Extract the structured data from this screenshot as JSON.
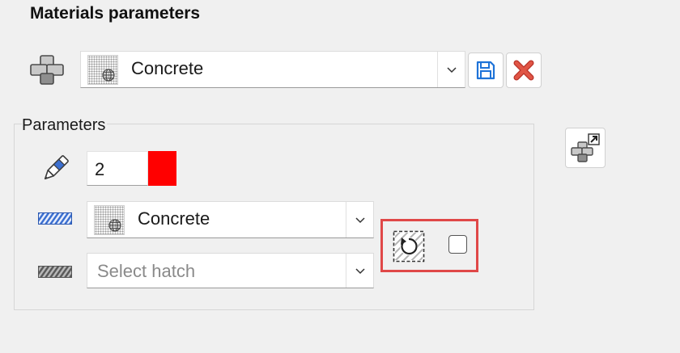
{
  "title": "Materials parameters",
  "material": {
    "selected": "Concrete",
    "thumbnail_icon": "globe-icon",
    "actions": [
      {
        "name": "save-button",
        "icon": "floppy-disk-icon",
        "color": "#1e73d8"
      },
      {
        "name": "delete-button",
        "icon": "red-x-icon",
        "color": "#d9453a"
      }
    ]
  },
  "parameters": {
    "label": "Parameters",
    "pen_width": "2",
    "pen_color": "#ff0000",
    "hatch": "Concrete",
    "second_hatch_placeholder": "Select hatch",
    "rotate_hatch_checked": false
  },
  "colors": {
    "highlight": "#e04848",
    "hatch_blue": "#3b6fd0",
    "hatch_gray": "#707070"
  }
}
